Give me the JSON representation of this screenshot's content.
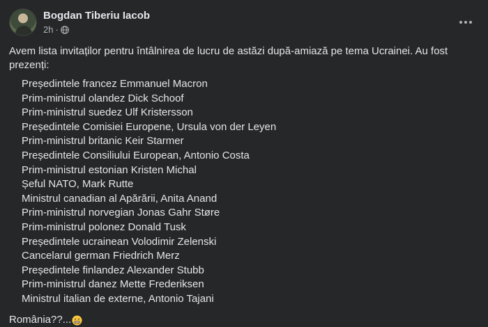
{
  "post": {
    "author": "Bogdan Tiberiu Iacob",
    "time": "2h",
    "separator": "·",
    "privacy_icon": "globe-icon",
    "more_icon": "more-options-icon",
    "intro_text": "Avem lista invitaților pentru întâlnirea de lucru de astăzi după-amiază pe tema Ucrainei. Au fost prezenți:",
    "attendees": [
      "Președintele francez Emmanuel Macron",
      "Prim-ministrul olandez Dick Schoof",
      "Prim-ministrul suedez Ulf Kristersson",
      "Președintele Comisiei Europene, Ursula von der Leyen",
      "Prim-ministrul britanic Keir Starmer",
      "Președintele Consiliului European, Antonio Costa",
      "Prim-ministrul estonian Kristen Michal",
      "Șeful NATO, Mark Rutte",
      "Ministrul canadian al Apărării, Anita Anand",
      "Prim-ministrul norvegian Jonas Gahr Støre",
      "Prim-ministrul polonez Donald Tusk",
      "Președintele ucrainean Volodimir Zelenski",
      "Cancelarul german Friedrich Merz",
      "Președintele finlandez Alexander Stubb",
      "Prim-ministrul danez Mette Frederiksen",
      "Ministrul italian de externe, Antonio Tajani"
    ],
    "closing_text": "România??...",
    "closing_emoji": "grimacing-face-emoji"
  },
  "colors": {
    "background": "#252728",
    "text_primary": "#e4e6eb",
    "text_secondary": "#b0b3b8"
  }
}
